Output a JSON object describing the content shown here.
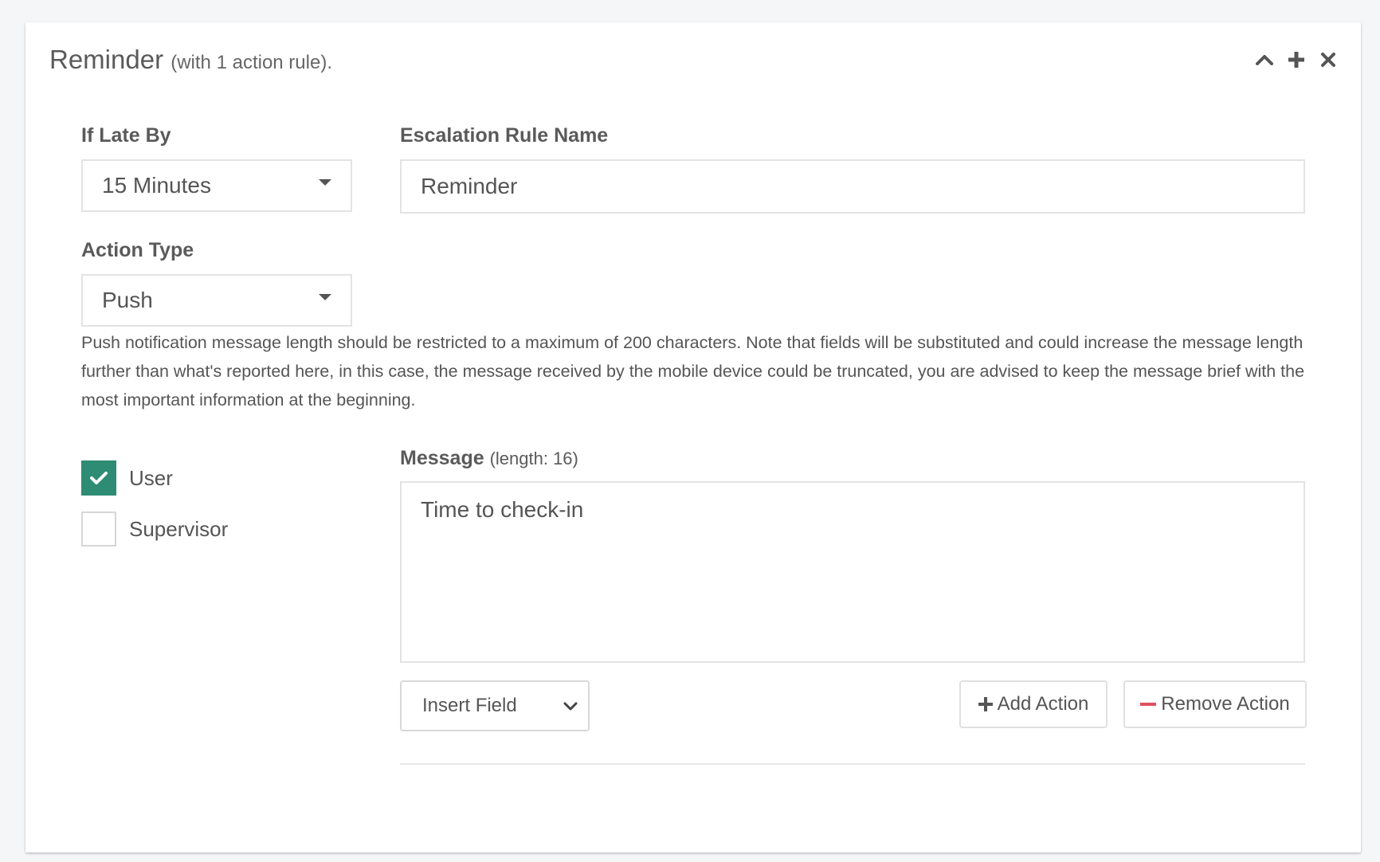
{
  "panel": {
    "title": "Reminder",
    "subtitle": "(with 1 action rule).",
    "tools": {
      "collapse_icon": "chevron-up-icon",
      "add_icon": "plus-icon",
      "close_icon": "close-icon"
    }
  },
  "late_by": {
    "label": "If Late By",
    "value": "15 Minutes"
  },
  "rule_name": {
    "label": "Escalation Rule Name",
    "value": "Reminder"
  },
  "action_type": {
    "label": "Action Type",
    "value": "Push"
  },
  "help_text": "Push notification message length should be restricted to a maximum of 200 characters. Note that fields will be substituted and could increase the message length further than what's reported here, in this case, the message received by the mobile device could be truncated, you are advised to keep the message brief with the most important information at the beginning.",
  "recipients": [
    {
      "label": "User",
      "checked": true
    },
    {
      "label": "Supervisor",
      "checked": false
    }
  ],
  "message": {
    "label": "Message",
    "length_note": "(length: 16)",
    "value": "Time to check-in"
  },
  "insert_field": {
    "label": "Insert Field"
  },
  "buttons": {
    "add_action": "Add Action",
    "remove_action": "Remove Action"
  },
  "colors": {
    "accent": "#2e8b74",
    "remove": "#e0505e"
  }
}
